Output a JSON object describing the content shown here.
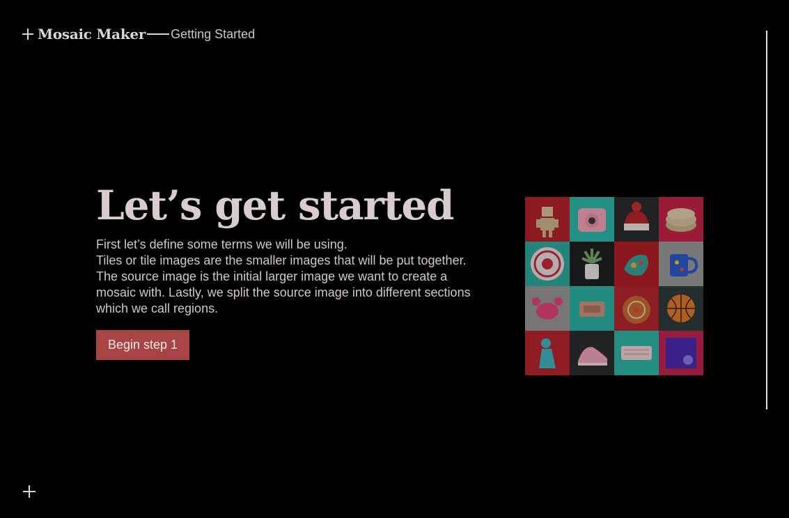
{
  "header": {
    "brand": "Mosaic Maker",
    "section": "Getting Started"
  },
  "main": {
    "title": "Let’s get started",
    "paragraph1": "First let’s define some terms we will be using.",
    "paragraph2": "Tiles or tile images are the smaller images that will be put together. The source image is the initial larger image we want to create a mosaic with. Lastly, we split the source image into different sections which we call regions.",
    "button_label": "Begin step 1"
  },
  "colors": {
    "accent": "#a84445",
    "background": "#000000",
    "text": "#d9cccc"
  },
  "mosaic": {
    "tiles": [
      {
        "subject": "robot",
        "bg": "#b5202b"
      },
      {
        "subject": "instant-camera",
        "bg": "#2fb8a8"
      },
      {
        "subject": "knit-hat",
        "bg": "#2a2b2e"
      },
      {
        "subject": "stack-of-tortillas",
        "bg": "#c42346"
      },
      {
        "subject": "decorative-plate",
        "bg": "#2fa99b"
      },
      {
        "subject": "potted-plant",
        "bg": "#1e1f21"
      },
      {
        "subject": "fabric-pouch",
        "bg": "#b21d24"
      },
      {
        "subject": "mug",
        "bg": "#9a9a9a"
      },
      {
        "subject": "pink-crab",
        "bg": "#9a9797"
      },
      {
        "subject": "palette",
        "bg": "#2db1a3"
      },
      {
        "subject": "ornament",
        "bg": "#b3262d"
      },
      {
        "subject": "basketball",
        "bg": "#2e3a3a"
      },
      {
        "subject": "blue-figurine",
        "bg": "#b8252e"
      },
      {
        "subject": "sneaker",
        "bg": "#2b2c2e"
      },
      {
        "subject": "keyboard",
        "bg": "#2eb5a6"
      },
      {
        "subject": "purple-notebook",
        "bg": "#c1244f"
      }
    ]
  }
}
